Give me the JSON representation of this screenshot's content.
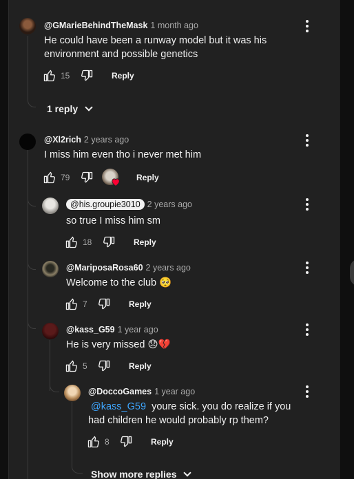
{
  "comments": [
    {
      "author": "@GMarieBehindTheMask",
      "time": "1 month ago",
      "text": "He could have been a runway model but it was his environment and possible genetics",
      "likes": "15",
      "reply_label": "Reply"
    },
    {
      "author": "@Xl2rich",
      "time": "2 years ago",
      "text": "I miss him even tho i never met him",
      "likes": "79",
      "reply_label": "Reply"
    }
  ],
  "replies_toggle": {
    "label": "1 reply"
  },
  "replies": [
    {
      "author": "@his.groupie3010",
      "time": "2 years ago",
      "text": "so true I miss him sm",
      "likes": "18",
      "reply_label": "Reply"
    },
    {
      "author": "@MariposaRosa60",
      "time": "2 years ago",
      "text": "Welcome to the club 🥺",
      "likes": "7",
      "reply_label": "Reply"
    },
    {
      "author": "@kass_G59",
      "time": "1 year ago",
      "text": "He is very missed 😞💔",
      "likes": "5",
      "reply_label": "Reply"
    },
    {
      "author": "@DoccoGames",
      "time": "1 year ago",
      "mention": "@kass_G59",
      "text": "youre sick. you do realize if you had children he would probably rp them?",
      "likes": "8",
      "reply_label": "Reply"
    }
  ],
  "show_more": {
    "label": "Show more replies"
  },
  "icons": {
    "like": "thumbs-up-icon",
    "dislike": "thumbs-down-icon",
    "more": "more-vert-icon",
    "creator_heart": "heart-icon"
  },
  "colors": {
    "background": "#212121",
    "link": "#3ea6ff",
    "heart": "#ff0033"
  }
}
